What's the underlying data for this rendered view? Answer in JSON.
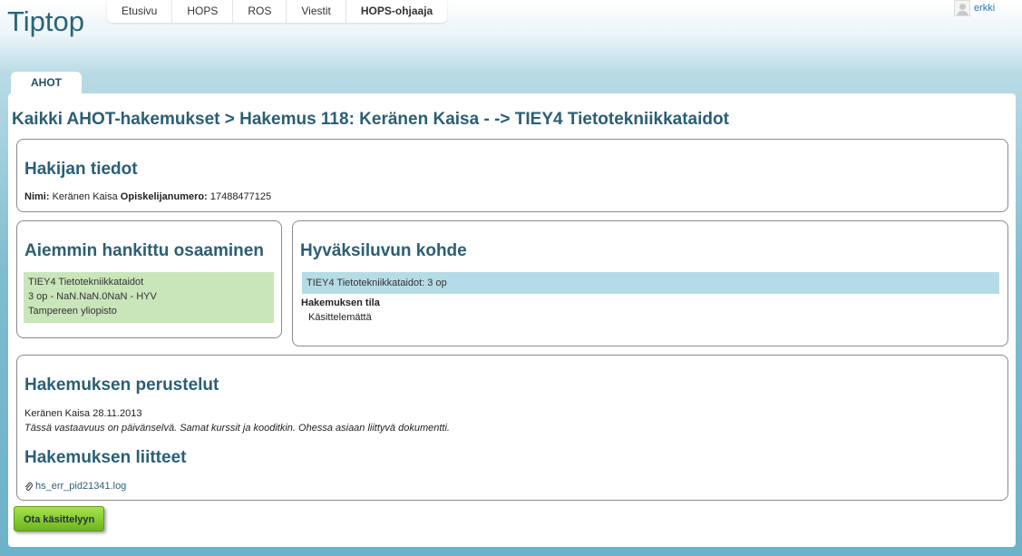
{
  "app": {
    "logo": "Tiptop"
  },
  "topnav": {
    "items": [
      "Etusivu",
      "HOPS",
      "ROS",
      "Viestit",
      "HOPS-ohjaaja"
    ]
  },
  "user": {
    "name": "erkki"
  },
  "tab": {
    "label": "AHOT"
  },
  "breadcrumb": "Kaikki AHOT-hakemukset > Hakemus 118: Keränen Kaisa - -> TIEY4 Tietotekniikkataidot",
  "applicant": {
    "heading": "Hakijan tiedot",
    "name_label": "Nimi:",
    "name_value": "Keränen Kaisa",
    "student_no_label": "Opiskelijanumero:",
    "student_no_value": "17488477125"
  },
  "prior": {
    "heading": "Aiemmin hankittu osaaminen",
    "lines": [
      "TIEY4 Tietotekniikkataidot",
      "3 op - NaN.NaN.0NaN - HYV",
      "Tampereen yliopisto"
    ]
  },
  "target": {
    "heading": "Hyväksiluvun kohde",
    "course": "TIEY4 Tietotekniikkataidot: 3 op",
    "status_label": "Hakemuksen tila",
    "status_value": "Käsittelemättä"
  },
  "rationale": {
    "heading": "Hakemuksen perustelut",
    "author_date": "Keränen Kaisa 28.11.2013",
    "text": "Tässä vastaavuus on päivänselvä. Samat kurssit ja kooditkin. Ohessa asiaan liittyvä dokumentti."
  },
  "attachments": {
    "heading": "Hakemuksen liitteet",
    "files": [
      "hs_err_pid21341.log"
    ]
  },
  "actions": {
    "take_label": "Ota käsittelyyn"
  },
  "colors": {
    "heading": "#2b5f74",
    "green_box": "#c9e6bb",
    "blue_box": "#b5dce6",
    "button": "#8fd13a"
  }
}
